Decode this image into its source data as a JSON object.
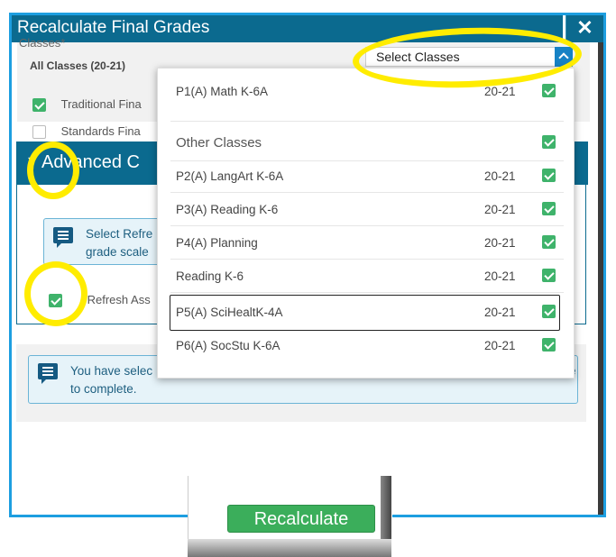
{
  "modal": {
    "title": "Recalculate Final Grades",
    "close_glyph": "✕"
  },
  "classes": {
    "label": "Classes*",
    "all_classes_label": "All Classes  (20-21)",
    "select_value": "Select Classes",
    "rows": [
      {
        "label": "Traditional Fina",
        "checked": true
      },
      {
        "label": "Standards Fina",
        "checked": false
      }
    ]
  },
  "advanced": {
    "header_arrow": "▼",
    "header_title": "Advanced C",
    "info_text_line1": "Select Refre",
    "info_text_line2": "grade scale",
    "refresh_label": "Refresh Ass",
    "refresh_checked": true
  },
  "lower_info": {
    "line1": "You have selec",
    "line1_tail": "e",
    "line2": "to complete."
  },
  "dropdown": {
    "top_item": {
      "name": "P1(A) Math K-6A",
      "year": "20-21",
      "checked": true
    },
    "group_label": "Other Classes",
    "group_checked": true,
    "items": [
      {
        "name": "P2(A) LangArt K-6A",
        "year": "20-21",
        "checked": true
      },
      {
        "name": "P3(A) Reading K-6",
        "year": "20-21",
        "checked": true
      },
      {
        "name": "P4(A) Planning",
        "year": "20-21",
        "checked": true
      },
      {
        "name": "Reading K-6",
        "year": "20-21",
        "checked": true
      },
      {
        "name": "P5(A) SciHealtK-4A",
        "year": "20-21",
        "checked": true
      },
      {
        "name": "P6(A) SocStu K-6A",
        "year": "20-21",
        "checked": true
      }
    ]
  },
  "footer": {
    "recalculate_label": "Recalculate"
  },
  "colors": {
    "header": "#0b6a8f",
    "accent_border": "#1d9ee0",
    "check_green": "#3fb36b",
    "button_green": "#3bae5b",
    "annotation_yellow": "#ffec00"
  },
  "icons": [
    "close-icon",
    "chevron-up-icon",
    "checkbox-checked-icon",
    "message-icon",
    "triangle-down-icon"
  ]
}
